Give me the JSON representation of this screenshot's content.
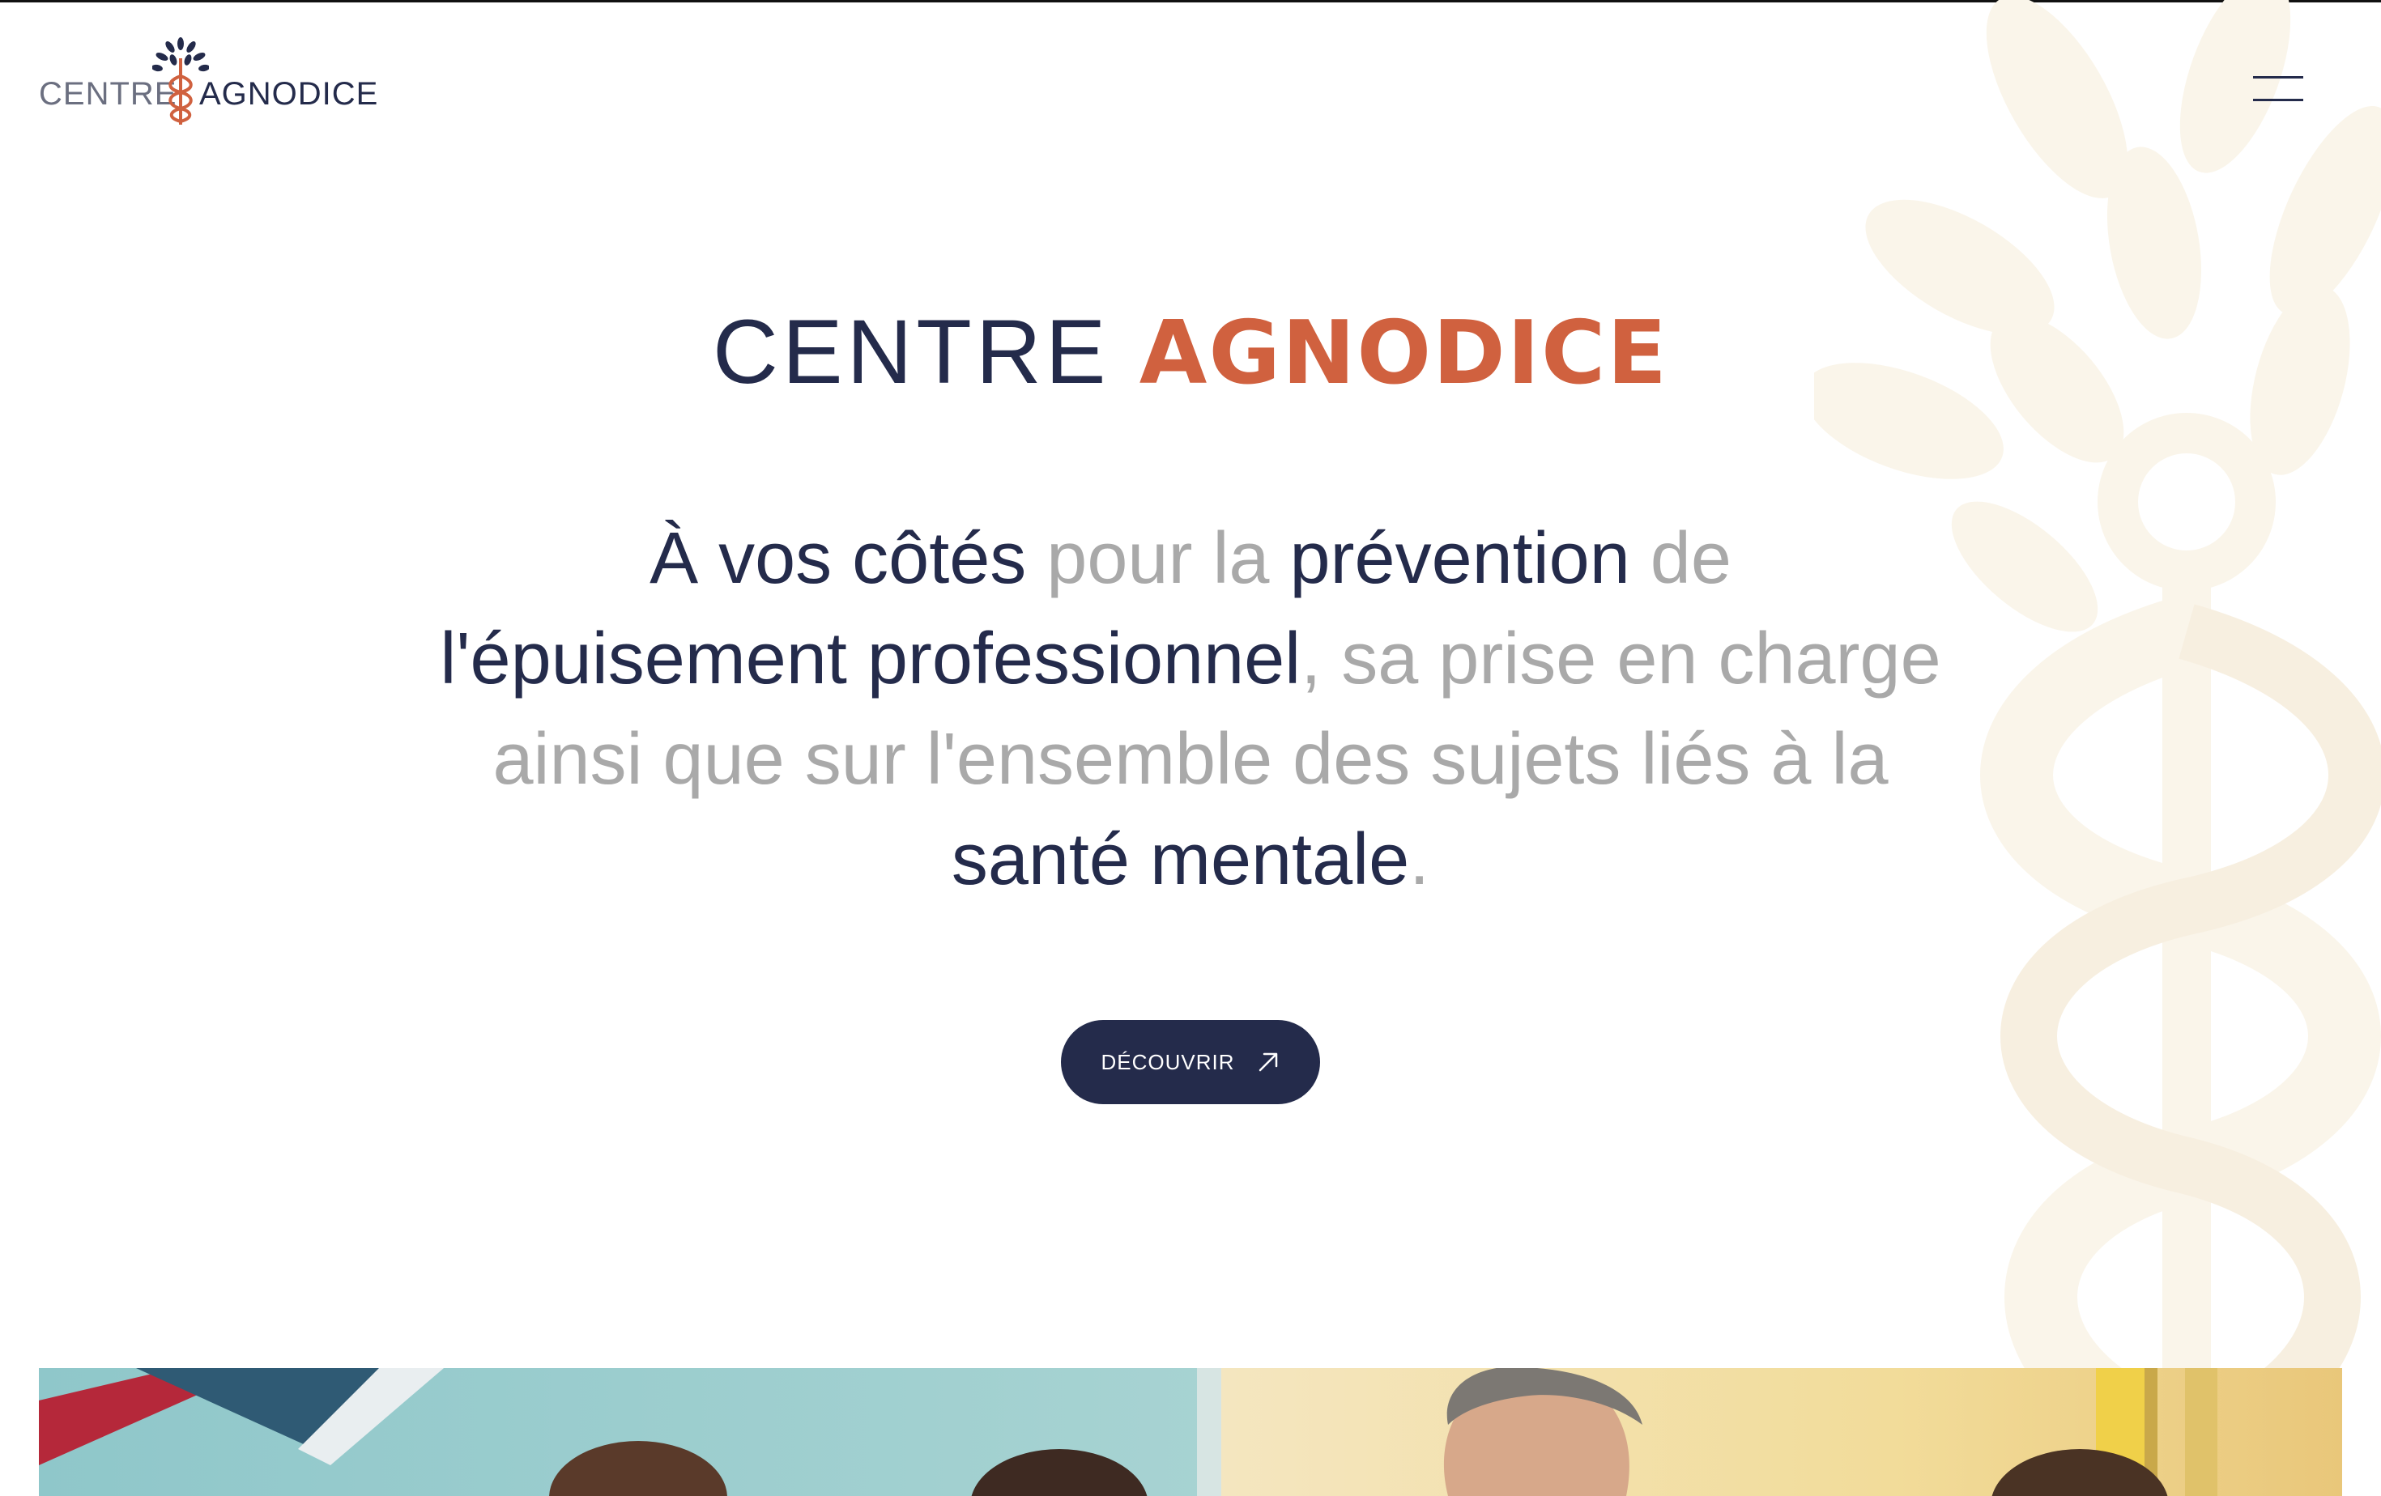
{
  "header": {
    "logo_text_left": "CENTRE",
    "logo_text_right": "AGNODICE",
    "menu_icon": "hamburger-icon"
  },
  "hero": {
    "title_light": "CENTRE",
    "title_bold": "AGNODICE",
    "tagline": {
      "line1_a": "À vos côtés",
      "line1_b": " pour la ",
      "line1_c": "prévention",
      "line1_d": " de",
      "line2_a": "l'épuisement professionnel",
      "line2_b": ", sa prise en charge",
      "line3": "ainsi que sur l'ensemble des sujets liés à la",
      "line4_a": "santé mentale",
      "line4_b": "."
    },
    "cta_label": "DÉCOUVRIR",
    "cta_icon": "arrow-up-right-icon"
  },
  "colors": {
    "navy": "#242b4b",
    "accent": "#d0613f",
    "muted_text": "#a9a9a9",
    "watermark": "#faf5ea"
  }
}
